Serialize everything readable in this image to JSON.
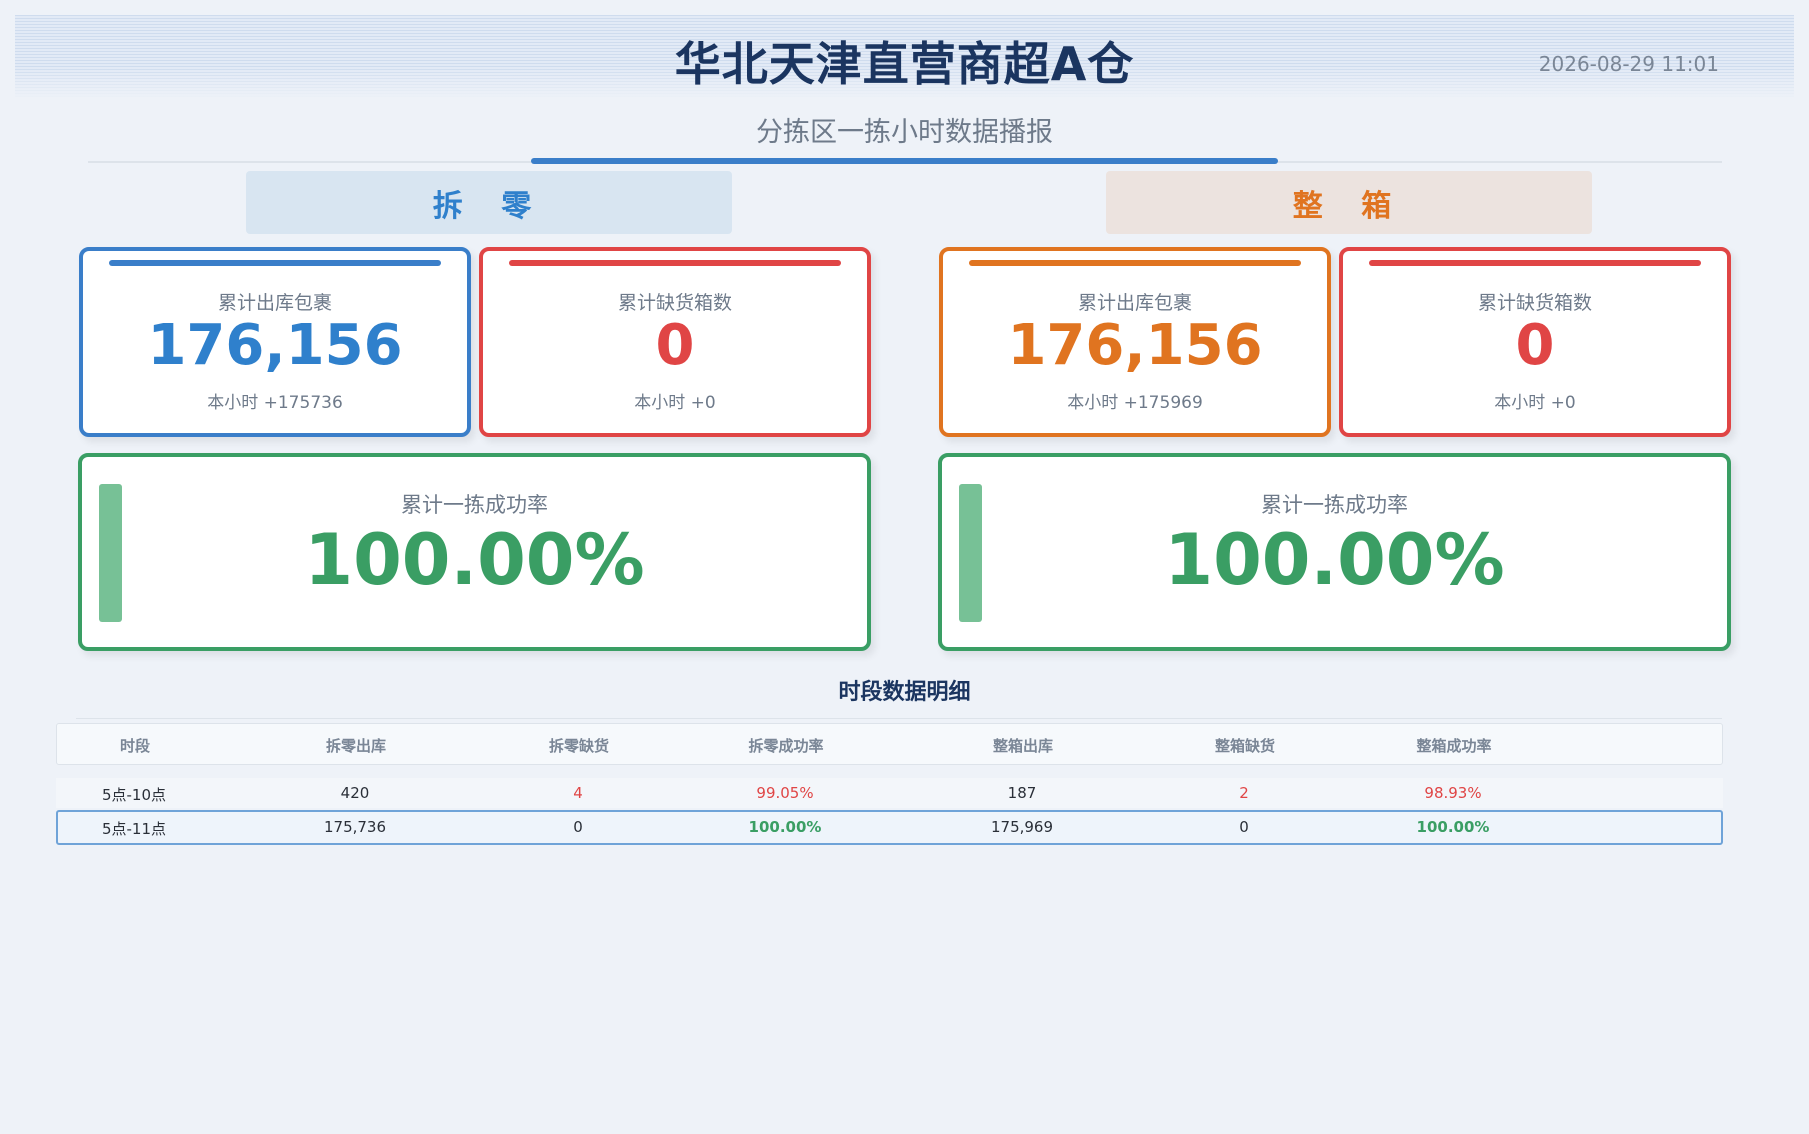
{
  "header": {
    "title": "华北天津直营商超A仓",
    "datetime": "2026-08-29 11:01",
    "subtitle": "分拣区一拣小时数据播报"
  },
  "sections": {
    "split": {
      "label": "拆 零",
      "color": "#2f80cc",
      "outbound": {
        "label": "累计出库包裹",
        "value": "176,156",
        "hour": "本小时 +175736"
      },
      "shortage": {
        "label": "累计缺货箱数",
        "value": "0",
        "hour": "本小时 +0"
      },
      "rate": {
        "label": "累计一拣成功率",
        "value": "100.00%"
      }
    },
    "box": {
      "label": "整 箱",
      "color": "#e07420",
      "outbound": {
        "label": "累计出库包裹",
        "value": "176,156",
        "hour": "本小时 +175969"
      },
      "shortage": {
        "label": "累计缺货箱数",
        "value": "0",
        "hour": "本小时 +0"
      },
      "rate": {
        "label": "累计一拣成功率",
        "value": "100.00%"
      }
    }
  },
  "detail": {
    "title": "时段数据明细",
    "columns": [
      "时段",
      "拆零出库",
      "拆零缺货",
      "拆零成功率",
      "整箱出库",
      "整箱缺货",
      "整箱成功率"
    ],
    "rows": [
      [
        "5点-10点",
        "420",
        "4",
        "99.05%",
        "187",
        "2",
        "98.93%"
      ],
      [
        "5点-11点",
        "175,736",
        "0",
        "100.00%",
        "175,969",
        "0",
        "100.00%"
      ]
    ]
  },
  "colors": {
    "red": "#e04545",
    "green": "#3a9e64",
    "blue": "#2f80cc",
    "orange": "#e07420",
    "title": "#1b3560"
  }
}
